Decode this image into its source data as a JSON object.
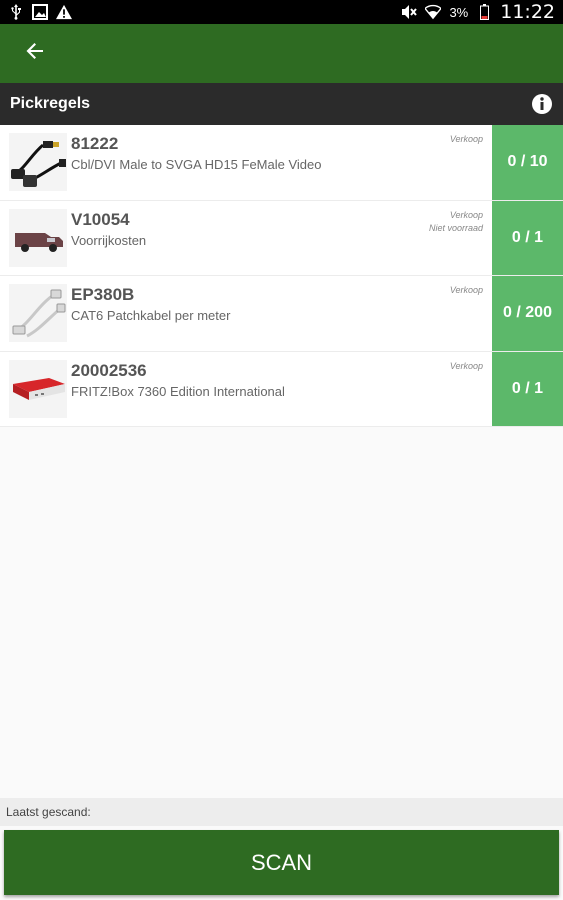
{
  "status_bar": {
    "battery_pct": "3%",
    "time": "11:22",
    "icons_left": [
      "usb-icon",
      "image-icon",
      "warning-icon"
    ],
    "icons_right": [
      "mute-icon",
      "wifi-icon",
      "battery-icon"
    ]
  },
  "app_bar": {
    "back_icon": "arrow-left-icon"
  },
  "section": {
    "title": "Pickregels",
    "info_icon": "info-icon"
  },
  "items": [
    {
      "code": "81222",
      "description": "Cbl/DVI Male to SVGA HD15 FeMale Video",
      "tags": [
        "Verkoop"
      ],
      "qty": "0 / 10",
      "thumb": "cable-image"
    },
    {
      "code": "V10054",
      "description": "Voorrijkosten",
      "tags": [
        "Verkoop",
        "Niet voorraad"
      ],
      "qty": "0 / 1",
      "thumb": "van-image"
    },
    {
      "code": "EP380B",
      "description": "CAT6 Patchkabel per meter",
      "tags": [
        "Verkoop"
      ],
      "qty": "0 / 200",
      "thumb": "patch-cable-image"
    },
    {
      "code": "20002536",
      "description": "FRITZ!Box 7360 Edition International",
      "tags": [
        "Verkoop"
      ],
      "qty": "0 / 1",
      "thumb": "router-image"
    }
  ],
  "footer": {
    "last_scanned_label": "Laatst gescand:",
    "scan_button_label": "SCAN"
  },
  "colors": {
    "app_bar": "#2e6b22",
    "qty_badge": "#5cb86a",
    "header": "#2b2b2b"
  }
}
